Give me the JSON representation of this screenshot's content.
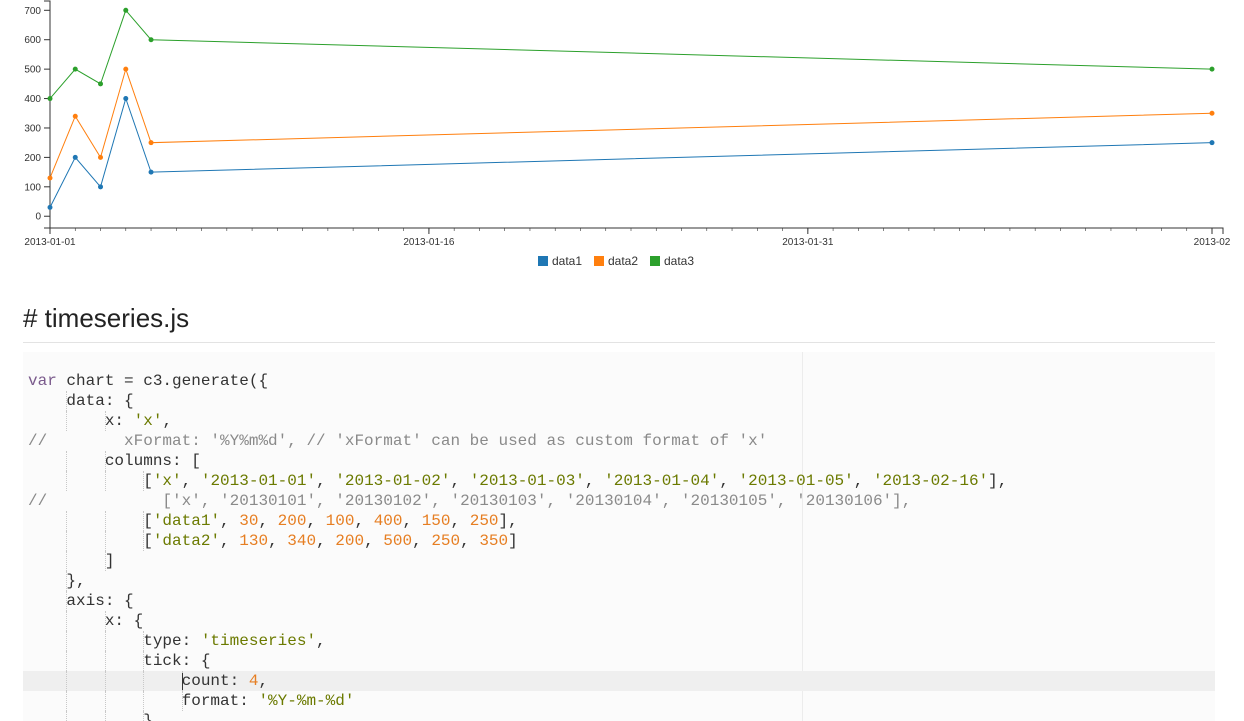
{
  "chart_data": {
    "type": "line",
    "x": [
      "2013-01-01",
      "2013-01-02",
      "2013-01-03",
      "2013-01-04",
      "2013-01-05",
      "2013-02-16"
    ],
    "series": [
      {
        "name": "data1",
        "color": "#1f77b4",
        "values": [
          30,
          200,
          100,
          400,
          150,
          250
        ]
      },
      {
        "name": "data2",
        "color": "#ff7f0e",
        "values": [
          130,
          340,
          200,
          500,
          250,
          350
        ]
      },
      {
        "name": "data3",
        "color": "#2ca02c",
        "values": [
          400,
          500,
          450,
          700,
          600,
          500
        ]
      }
    ],
    "y_ticks": [
      "0",
      "100",
      "200",
      "300",
      "400",
      "500",
      "600",
      "700"
    ],
    "x_ticks": [
      {
        "date": "2013-01-01",
        "label": "2013-01-01"
      },
      {
        "date": "2013-01-16",
        "label": "2013-01-16"
      },
      {
        "date": "2013-01-31",
        "label": "2013-01-31"
      },
      {
        "date": "2013-02-16",
        "label": "2013-02"
      }
    ],
    "xlim": [
      "2013-01-01",
      "2013-02-16"
    ],
    "ylim": [
      -40,
      735
    ],
    "grid": false,
    "legend": "bottom-center"
  },
  "section": {
    "title": "# timeseries.js"
  },
  "code": {
    "lines": [
      [
        [
          "keyword",
          "var"
        ],
        [
          "plain",
          " chart = c3.generate({"
        ]
      ],
      [
        [
          "plain",
          "    data: {"
        ]
      ],
      [
        [
          "plain",
          "        x: "
        ],
        [
          "string",
          "'x'"
        ],
        [
          "plain",
          ","
        ]
      ],
      [
        [
          "comment",
          "//        xFormat: '%Y%m%d', // 'xFormat' can be used as custom format of 'x'"
        ]
      ],
      [
        [
          "plain",
          "        columns: ["
        ]
      ],
      [
        [
          "plain",
          "            ["
        ],
        [
          "string",
          "'x'"
        ],
        [
          "plain",
          ", "
        ],
        [
          "string",
          "'2013-01-01'"
        ],
        [
          "plain",
          ", "
        ],
        [
          "string",
          "'2013-01-02'"
        ],
        [
          "plain",
          ", "
        ],
        [
          "string",
          "'2013-01-03'"
        ],
        [
          "plain",
          ", "
        ],
        [
          "string",
          "'2013-01-04'"
        ],
        [
          "plain",
          ", "
        ],
        [
          "string",
          "'2013-01-05'"
        ],
        [
          "plain",
          ", "
        ],
        [
          "string",
          "'2013-02-16'"
        ],
        [
          "plain",
          "],"
        ]
      ],
      [
        [
          "comment",
          "//            ['x', '20130101', '20130102', '20130103', '20130104', '20130105', '20130106'],"
        ]
      ],
      [
        [
          "plain",
          "            ["
        ],
        [
          "string",
          "'data1'"
        ],
        [
          "plain",
          ", "
        ],
        [
          "number",
          "30"
        ],
        [
          "plain",
          ", "
        ],
        [
          "number",
          "200"
        ],
        [
          "plain",
          ", "
        ],
        [
          "number",
          "100"
        ],
        [
          "plain",
          ", "
        ],
        [
          "number",
          "400"
        ],
        [
          "plain",
          ", "
        ],
        [
          "number",
          "150"
        ],
        [
          "plain",
          ", "
        ],
        [
          "number",
          "250"
        ],
        [
          "plain",
          "],"
        ]
      ],
      [
        [
          "plain",
          "            ["
        ],
        [
          "string",
          "'data2'"
        ],
        [
          "plain",
          ", "
        ],
        [
          "number",
          "130"
        ],
        [
          "plain",
          ", "
        ],
        [
          "number",
          "340"
        ],
        [
          "plain",
          ", "
        ],
        [
          "number",
          "200"
        ],
        [
          "plain",
          ", "
        ],
        [
          "number",
          "500"
        ],
        [
          "plain",
          ", "
        ],
        [
          "number",
          "250"
        ],
        [
          "plain",
          ", "
        ],
        [
          "number",
          "350"
        ],
        [
          "plain",
          "]"
        ]
      ],
      [
        [
          "plain",
          "        ]"
        ]
      ],
      [
        [
          "plain",
          "    },"
        ]
      ],
      [
        [
          "plain",
          "    axis: {"
        ]
      ],
      [
        [
          "plain",
          "        x: {"
        ]
      ],
      [
        [
          "plain",
          "            type: "
        ],
        [
          "string",
          "'timeseries'"
        ],
        [
          "plain",
          ","
        ]
      ],
      [
        [
          "plain",
          "            tick: {"
        ]
      ],
      [
        [
          "plain",
          "                count: "
        ],
        [
          "number",
          "4"
        ],
        [
          "plain",
          ","
        ]
      ],
      [
        [
          "plain",
          "                format: "
        ],
        [
          "string",
          "'%Y-%m-%d'"
        ]
      ],
      [
        [
          "plain",
          "            }"
        ]
      ]
    ],
    "active_line": 15
  }
}
